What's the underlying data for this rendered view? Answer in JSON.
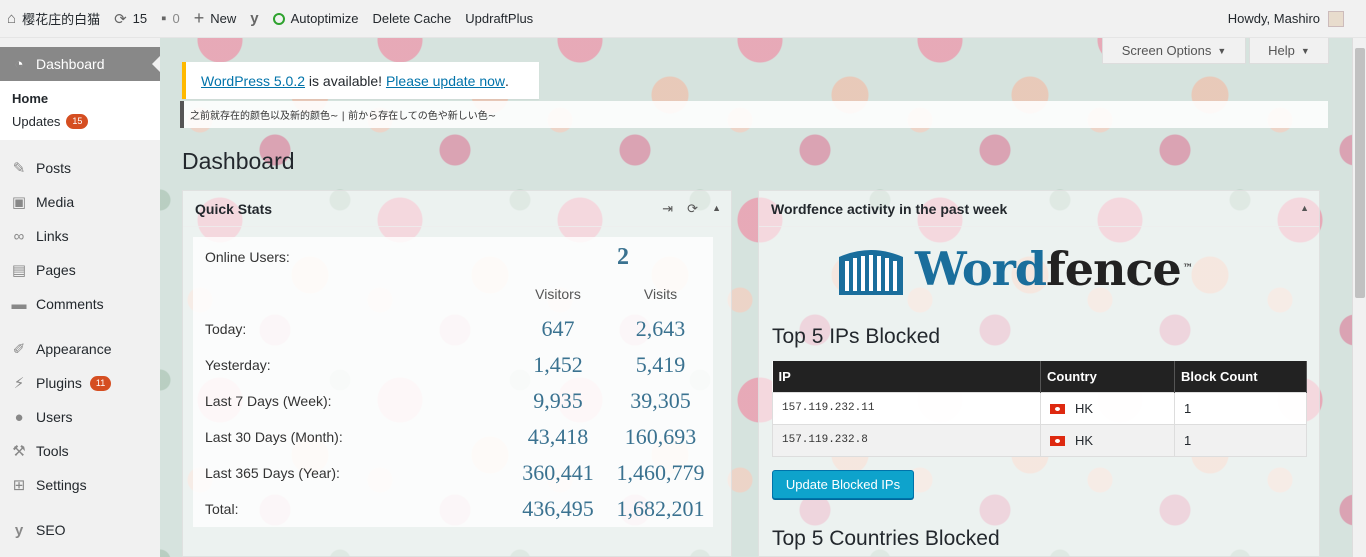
{
  "adminbar": {
    "site_name": "樱花庄的白猫",
    "updates_count": "15",
    "comments_count": "0",
    "new_label": "New",
    "autoptimize_label": "Autoptimize",
    "delete_cache_label": "Delete Cache",
    "updraftplus_label": "UpdraftPlus",
    "howdy": "Howdy, Mashiro"
  },
  "sidebar": {
    "dashboard": "Dashboard",
    "home": "Home",
    "updates": "Updates",
    "updates_badge": "15",
    "posts": "Posts",
    "media": "Media",
    "links": "Links",
    "pages": "Pages",
    "comments": "Comments",
    "appearance": "Appearance",
    "plugins": "Plugins",
    "plugins_badge": "11",
    "users": "Users",
    "tools": "Tools",
    "settings": "Settings",
    "seo": "SEO"
  },
  "screen_options": "Screen Options",
  "help": "Help",
  "notice": {
    "version_link": "WordPress 5.0.2",
    "middle": " is available! ",
    "update_link": "Please update now",
    "end": "."
  },
  "quote": "之前就存在的颜色以及新的颜色~ | 前から存在しての色や新しい色~",
  "page_title": "Dashboard",
  "quick_stats": {
    "title": "Quick Stats",
    "online_label": "Online Users:",
    "online_value": "2",
    "col_visitors": "Visitors",
    "col_visits": "Visits",
    "rows": [
      {
        "label": "Today:",
        "visitors": "647",
        "visits": "2,643"
      },
      {
        "label": "Yesterday:",
        "visitors": "1,452",
        "visits": "5,419"
      },
      {
        "label": "Last 7 Days (Week):",
        "visitors": "9,935",
        "visits": "39,305"
      },
      {
        "label": "Last 30 Days (Month):",
        "visitors": "43,418",
        "visits": "160,693"
      },
      {
        "label": "Last 365 Days (Year):",
        "visitors": "360,441",
        "visits": "1,460,779"
      },
      {
        "label": "Total:",
        "visitors": "436,495",
        "visits": "1,682,201"
      }
    ]
  },
  "wordfence": {
    "title": "Wordfence activity in the past week",
    "logo_part1": "Word",
    "logo_part2": "fence",
    "logo_tm": "™",
    "top_ips_heading": "Top 5 IPs Blocked",
    "col_ip": "IP",
    "col_country": "Country",
    "col_count": "Block Count",
    "rows": [
      {
        "ip": "157.119.232.11",
        "country": "HK",
        "count": "1"
      },
      {
        "ip": "157.119.232.8",
        "country": "HK",
        "count": "1"
      }
    ],
    "update_button": "Update Blocked IPs",
    "top_countries_heading": "Top 5 Countries Blocked"
  },
  "colors": {
    "accent": "#0073aa",
    "badge": "#d54e21",
    "wordfence_button": "#0ea3cc",
    "stat_number": "#3a7290"
  }
}
